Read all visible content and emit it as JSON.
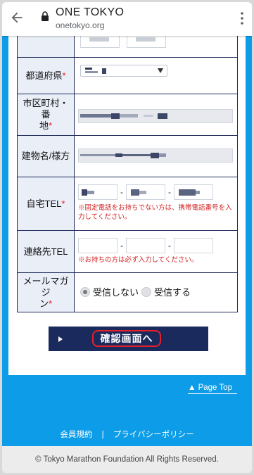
{
  "browser": {
    "title": "ONE TOKYO",
    "url": "onetokyo.org",
    "back_icon": "arrow-back-icon",
    "lock_icon": "lock-icon",
    "menu_icon": "more-vert-icon"
  },
  "form": {
    "required_mark": "*",
    "prefecture": {
      "label": "都道府県"
    },
    "city": {
      "label_line1": "市区町村・番",
      "label_line2": "地"
    },
    "building": {
      "label": "建物名/様方"
    },
    "home_tel": {
      "label": "自宅TEL",
      "separator": "-",
      "note": "※固定電話をお持ちでない方は、携帯電話番号を入力してください。"
    },
    "contact_tel": {
      "label": "連絡先TEL",
      "separator": "-",
      "note": "※お持ちの方は必ず入力してください。"
    },
    "newsletter": {
      "label_line1": "メールマガジ",
      "label_line2": "ン",
      "options": [
        {
          "label": "受信しない",
          "checked": true
        },
        {
          "label": "受信する",
          "checked": false
        }
      ]
    }
  },
  "confirm_button": {
    "label": "確認画面へ"
  },
  "page_top": {
    "label": "▲ Page Top"
  },
  "footer": {
    "links": [
      "会員規約",
      "プライバシーポリシー"
    ],
    "separator": "|",
    "copyright": "© Tokyo Marathon Foundation All Rights Reserved."
  },
  "colors": {
    "page_blue": "#0d9de8",
    "navy": "#1a2a5c",
    "required_red": "#e02020",
    "highlight_red": "#e8202a"
  }
}
